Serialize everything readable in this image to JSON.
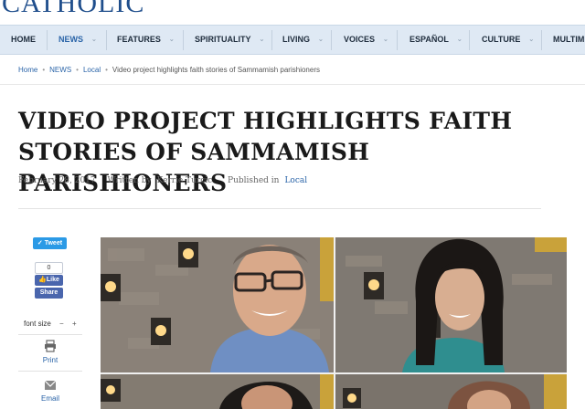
{
  "masthead": {
    "logo_text": "CATHOLIC"
  },
  "nav": {
    "items": [
      {
        "label": "HOME",
        "dropdown": false
      },
      {
        "label": "NEWS",
        "dropdown": true,
        "active": true
      },
      {
        "label": "FEATURES",
        "dropdown": true
      },
      {
        "label": "SPIRITUALITY",
        "dropdown": true
      },
      {
        "label": "LIVING",
        "dropdown": true
      },
      {
        "label": "VOICES",
        "dropdown": true
      },
      {
        "label": "ESPAÑOL",
        "dropdown": true
      },
      {
        "label": "CULTURE",
        "dropdown": true
      },
      {
        "label": "MULTIMI",
        "dropdown": false
      }
    ],
    "chevron": "⌄"
  },
  "breadcrumb": {
    "home": "Home",
    "news": "NEWS",
    "local": "Local",
    "current": "Video project highlights faith stories of Sammamish parishioners",
    "separator": "•"
  },
  "article": {
    "title": "VIDEO PROJECT HIGHLIGHTS FAITH STORIES OF SAMMAMISH PARISHIONERS",
    "date": "February 28, 2017",
    "written_by_label": "Written by",
    "author": "Kerrie Turcic",
    "published_in_label": "Published in",
    "section": "Local"
  },
  "share": {
    "tweet_label": "Tweet",
    "like_count": "0",
    "like_label": "Like",
    "share_label": "Share",
    "font_size_label": "font size",
    "font_minus": "−",
    "font_plus": "+",
    "print_label": "Print",
    "email_label": "Email"
  },
  "colors": {
    "accent": "#2a64a8",
    "nav_bg": "#dfe9f4",
    "tweet": "#2b9ae6",
    "facebook": "#4a66ad"
  },
  "photo": {
    "icon": "video-still-image"
  }
}
